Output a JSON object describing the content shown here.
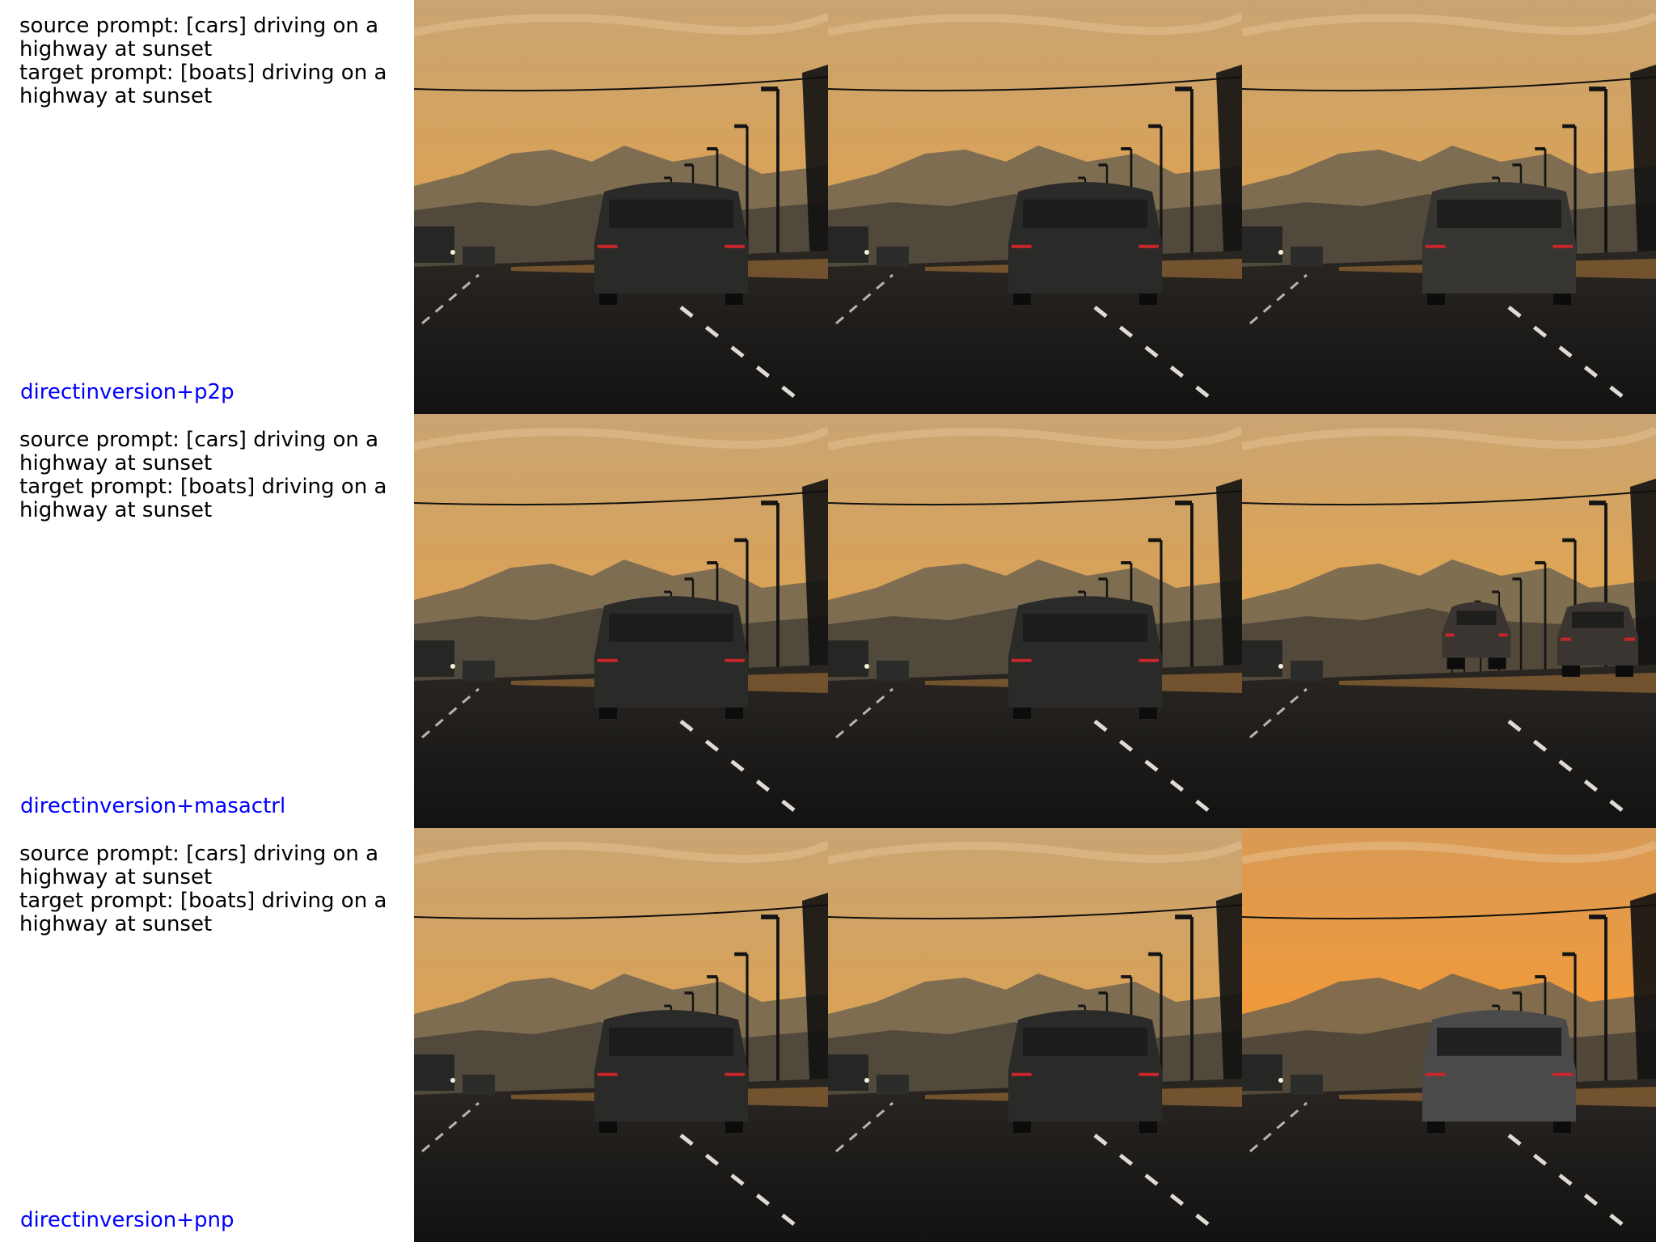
{
  "rows": [
    {
      "source_prompt": "source prompt: [cars] driving on a highway at sunset",
      "target_prompt": "target prompt: [boats] driving on a highway at sunset",
      "method": "directinversion+p2p",
      "panels": [
        {
          "variant": "source",
          "car_tone": "#2a2a28",
          "sky_tone": "#d9a257"
        },
        {
          "variant": "reconstruction",
          "car_tone": "#2a2a28",
          "sky_tone": "#d9a257"
        },
        {
          "variant": "edit",
          "car_tone": "#363532",
          "sky_tone": "#d8a257"
        }
      ]
    },
    {
      "source_prompt": "source prompt: [cars] driving on a highway at sunset",
      "target_prompt": "target prompt: [boats] driving on a highway at sunset",
      "method": "directinversion+masactrl",
      "panels": [
        {
          "variant": "source",
          "car_tone": "#2a2a28",
          "sky_tone": "#d9a257"
        },
        {
          "variant": "reconstruction",
          "car_tone": "#2a2a28",
          "sky_tone": "#d9a257"
        },
        {
          "variant": "edit-two-vehicles",
          "car_tone": "#3a3530",
          "sky_tone": "#e0a552"
        }
      ]
    },
    {
      "source_prompt": "source prompt: [cars] driving on a highway at sunset",
      "target_prompt": "target prompt: [boats] driving on a highway at sunset",
      "method": "directinversion+pnp",
      "panels": [
        {
          "variant": "source",
          "car_tone": "#2a2a28",
          "sky_tone": "#d9a257"
        },
        {
          "variant": "reconstruction",
          "car_tone": "#2a2a28",
          "sky_tone": "#d9a257"
        },
        {
          "variant": "edit-orange",
          "car_tone": "#4a4a4a",
          "sky_tone": "#f09a3a"
        }
      ]
    }
  ]
}
